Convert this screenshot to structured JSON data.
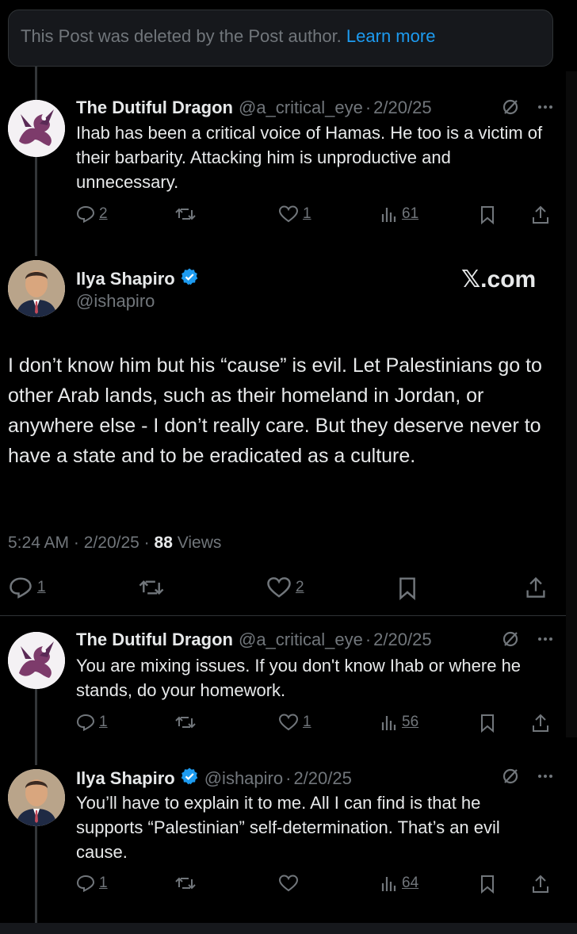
{
  "deleted_notice": {
    "text": "This Post was deleted by the Post author.",
    "link": "Learn more"
  },
  "reply1": {
    "name": "The Dutiful Dragon",
    "handle": "@a_critical_eye",
    "date": "2/20/25",
    "text": "Ihab has been a critical voice of Hamas. He too is a victim of their barbarity. Attacking him is unproductive and unnecessary.",
    "replies": "2",
    "reposts": "",
    "likes": "1",
    "views": "61"
  },
  "main_post": {
    "name": "Ilya Shapiro",
    "handle": "@ishapiro",
    "watermark": "𝕏.com",
    "text": "I don’t know him but his “cause” is evil. Let Palestinians go to other Arab lands, such as their homeland in Jordan, or anywhere else - I don’t really care. But they deserve never to have a state and to be eradicated as a culture.",
    "time": "5:24 AM",
    "date": "2/20/25",
    "views_count": "88",
    "views_label": "Views",
    "replies": "1",
    "likes": "2"
  },
  "reply2": {
    "name": "The Dutiful Dragon",
    "handle": "@a_critical_eye",
    "date": "2/20/25",
    "text": "You are mixing issues. If you don't know Ihab or where he stands, do your homework.",
    "replies": "1",
    "likes": "1",
    "views": "56"
  },
  "reply3": {
    "name": "Ilya Shapiro",
    "handle": "@ishapiro",
    "date": "2/20/25",
    "text": "You’ll have to explain it to me. All I can find is that he supports “Palestinian” self-determination. That’s an evil cause.",
    "replies": "1",
    "likes": "",
    "views": "64"
  },
  "separator": "·",
  "colors": {
    "accent": "#1d9bf0",
    "muted": "#71767b",
    "background": "#000000"
  }
}
